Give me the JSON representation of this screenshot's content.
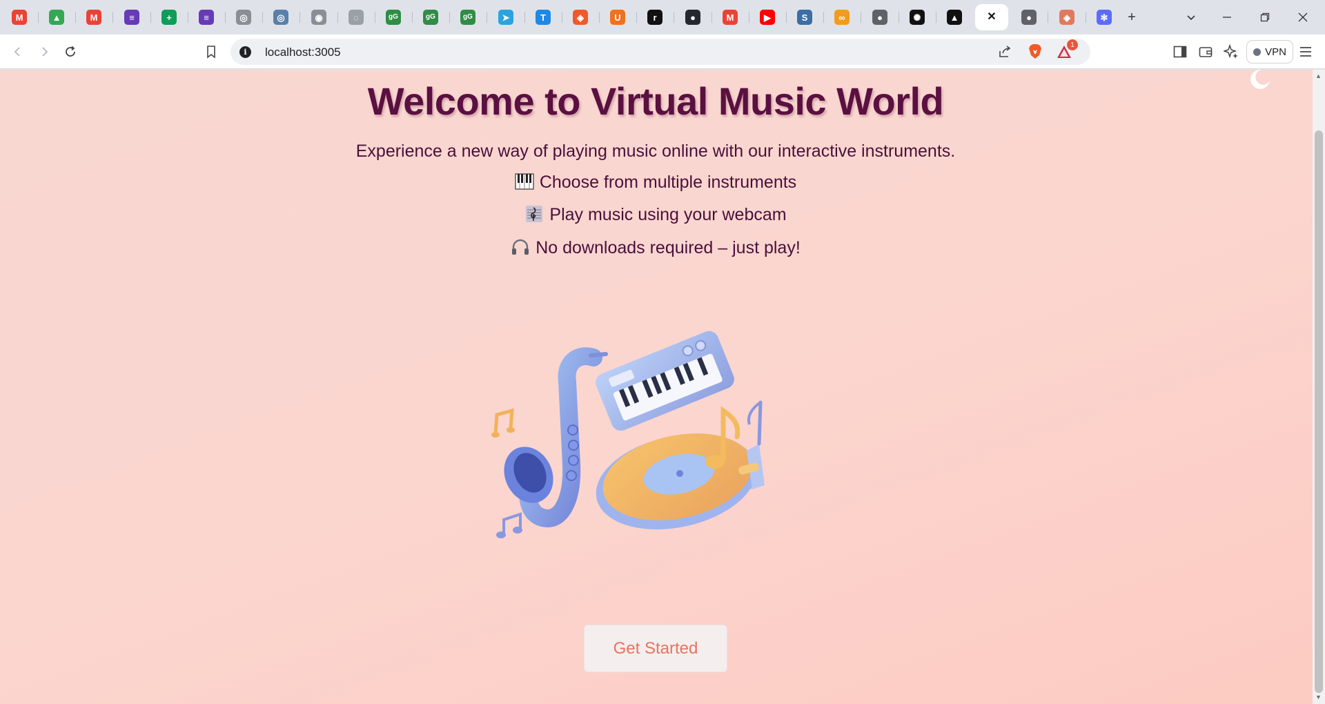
{
  "browser": {
    "tabs": [
      {
        "icon": "gmail-icon",
        "color": "#ea4335",
        "glyph": "M"
      },
      {
        "icon": "google-drive-icon",
        "color": "#34a853",
        "glyph": "▲"
      },
      {
        "icon": "gmail-icon",
        "color": "#ea4335",
        "glyph": "M"
      },
      {
        "icon": "google-forms-icon",
        "color": "#673ab7",
        "glyph": "≡"
      },
      {
        "icon": "google-sheets-icon",
        "color": "#0f9d58",
        "glyph": "+"
      },
      {
        "icon": "google-forms-icon",
        "color": "#673ab7",
        "glyph": "≡"
      },
      {
        "icon": "gray-circle-icon",
        "color": "#8a8f96",
        "glyph": "◎"
      },
      {
        "icon": "gray-circle-icon",
        "color": "#5a7fa8",
        "glyph": "◎"
      },
      {
        "icon": "gray-circle-icon",
        "color": "#8a8f96",
        "glyph": "◉"
      },
      {
        "icon": "gray-circle-icon",
        "color": "#9aa0a6",
        "glyph": "◌"
      },
      {
        "icon": "geeksforgeeks-icon",
        "color": "#2f8d46",
        "glyph": "gG"
      },
      {
        "icon": "geeksforgeeks-icon",
        "color": "#2f8d46",
        "glyph": "gG"
      },
      {
        "icon": "geeksforgeeks-icon",
        "color": "#2f8d46",
        "glyph": "gG"
      },
      {
        "icon": "telegram-icon",
        "color": "#2aa3df",
        "glyph": "➤"
      },
      {
        "icon": "t-logo-icon",
        "color": "#1e88e5",
        "glyph": "T"
      },
      {
        "icon": "brave-shield-icon",
        "color": "#f05a28",
        "glyph": "◈"
      },
      {
        "icon": "orange-u-icon",
        "color": "#f0711f",
        "glyph": "U"
      },
      {
        "icon": "r-logo-icon",
        "color": "#111111",
        "glyph": "r"
      },
      {
        "icon": "github-icon",
        "color": "#24292f",
        "glyph": "●"
      },
      {
        "icon": "gmail-icon",
        "color": "#ea4335",
        "glyph": "M"
      },
      {
        "icon": "youtube-icon",
        "color": "#ff0000",
        "glyph": "▶"
      },
      {
        "icon": "s-logo-icon",
        "color": "#3b6ea5",
        "glyph": "S"
      },
      {
        "icon": "infinity-icon",
        "color": "#f29b1d",
        "glyph": "∞"
      },
      {
        "icon": "globe-icon",
        "color": "#5f6368",
        "glyph": "●"
      },
      {
        "icon": "openai-icon",
        "color": "#111111",
        "glyph": "✺"
      },
      {
        "icon": "triangle-logo-icon",
        "color": "#111111",
        "glyph": "▲"
      },
      {
        "icon": "close-tab-icon",
        "color": "#111111",
        "glyph": "✕",
        "active": true
      },
      {
        "icon": "globe-icon",
        "color": "#5f6368",
        "glyph": "●"
      },
      {
        "icon": "brave-shield-icon",
        "color": "#e07a5f",
        "glyph": "◈"
      },
      {
        "icon": "snowflake-icon",
        "color": "#5b6cff",
        "glyph": "✻"
      }
    ],
    "url": "localhost:3005",
    "vpn_label": "VPN",
    "rewards_badge": "1"
  },
  "page": {
    "title": "Welcome to Virtual Music World",
    "subtitle": "Experience a new way of playing music online with our interactive instruments.",
    "features": [
      {
        "icon": "piano-keys-icon",
        "text": "Choose from multiple instruments"
      },
      {
        "icon": "music-score-icon",
        "text": "Play music using your webcam"
      },
      {
        "icon": "headphones-icon",
        "text": "No downloads required – just play!"
      }
    ],
    "cta_label": "Get Started",
    "colors": {
      "title": "#5a1040",
      "text": "#4a0f3a",
      "cta_text": "#e8735e",
      "bg_start": "#f8d7d1",
      "bg_end": "#fccbc2"
    }
  }
}
